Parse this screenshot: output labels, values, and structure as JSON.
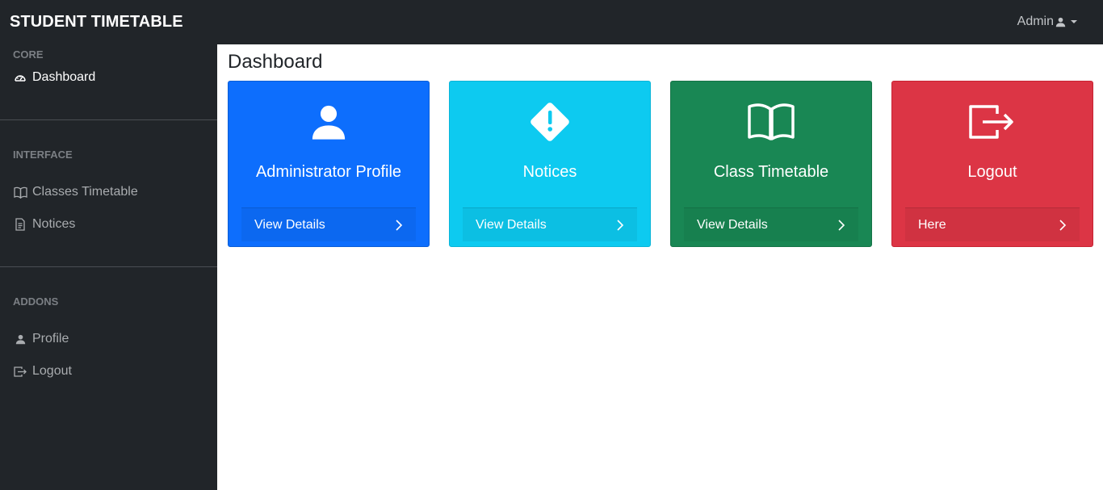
{
  "app": {
    "title": "STUDENT TIMETABLE"
  },
  "user_menu": {
    "label": "Admin"
  },
  "sidebar": {
    "sections": [
      {
        "label": "CORE",
        "items": [
          {
            "label": "Dashboard",
            "icon": "speedometer-icon"
          }
        ]
      },
      {
        "label": "INTERFACE",
        "items": [
          {
            "label": "Classes Timetable",
            "icon": "book-icon"
          },
          {
            "label": "Notices",
            "icon": "document-icon"
          }
        ]
      },
      {
        "label": "ADDONS",
        "items": [
          {
            "label": "Profile",
            "icon": "person-icon"
          },
          {
            "label": "Logout",
            "icon": "logout-icon"
          }
        ]
      }
    ]
  },
  "main": {
    "title": "Dashboard",
    "cards": [
      {
        "title": "Administrator Profile",
        "footer": "View Details",
        "color": "#0d6efd",
        "icon": "person-icon"
      },
      {
        "title": "Notices",
        "footer": "View Details",
        "color": "#0dcaf0",
        "icon": "warning-diamond-icon"
      },
      {
        "title": "Class Timetable",
        "footer": "View Details",
        "color": "#198754",
        "icon": "book-icon"
      },
      {
        "title": "Logout",
        "footer": "Here",
        "color": "#dc3545",
        "icon": "logout-icon"
      }
    ]
  }
}
